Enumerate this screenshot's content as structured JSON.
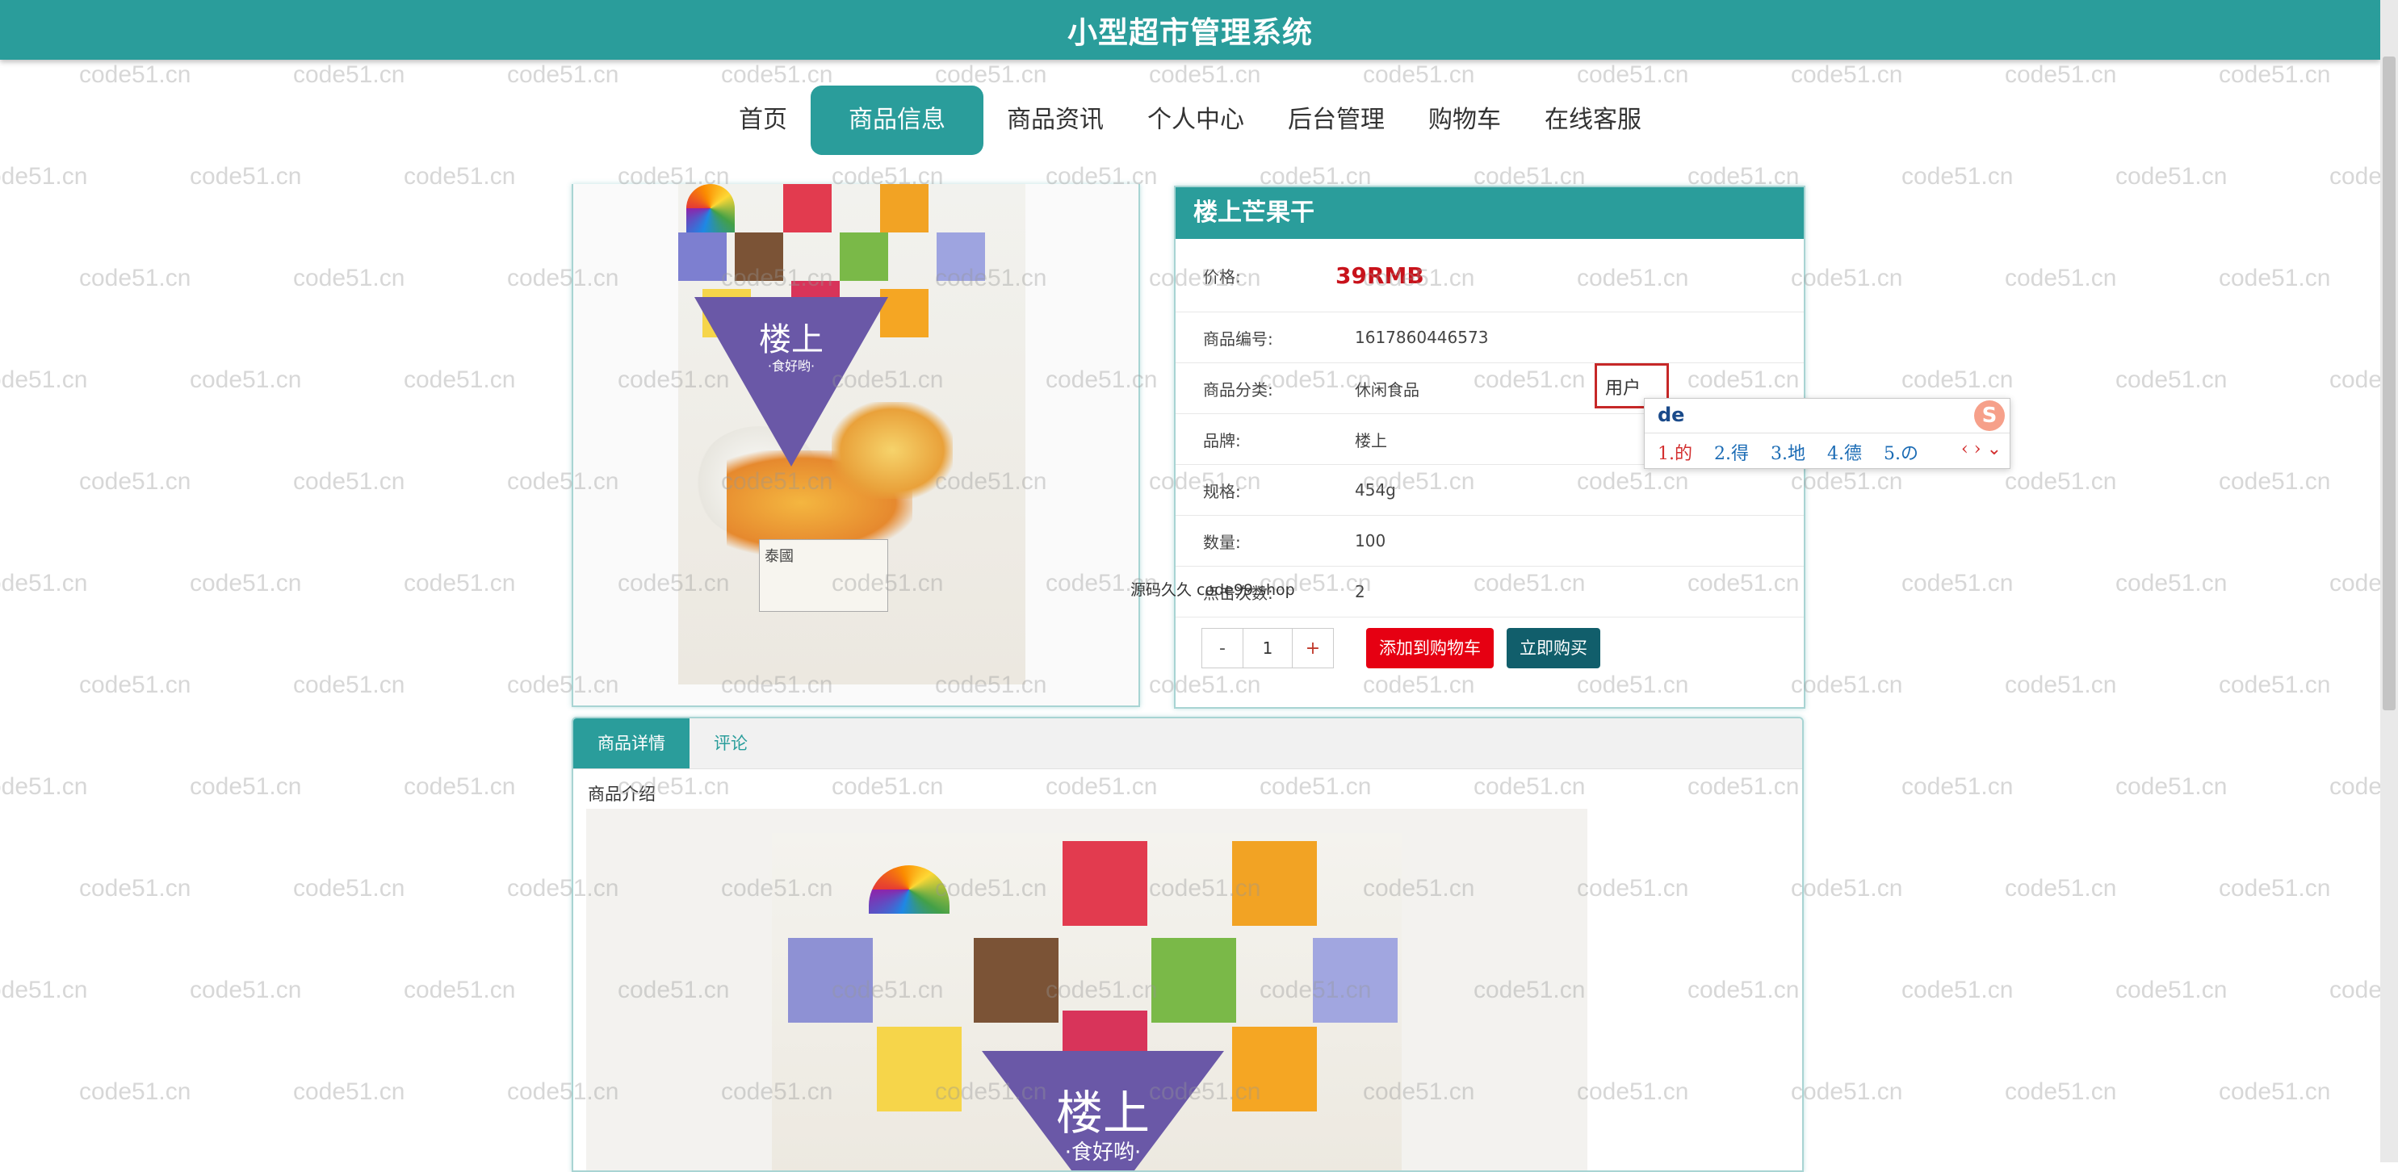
{
  "app": {
    "title": "小型超市管理系统"
  },
  "nav": {
    "items": [
      {
        "label": "首页"
      },
      {
        "label": "商品信息"
      },
      {
        "label": "商品资讯"
      },
      {
        "label": "个人中心"
      },
      {
        "label": "后台管理"
      },
      {
        "label": "购物车"
      },
      {
        "label": "在线客服"
      }
    ],
    "active": "商品信息"
  },
  "watermark": "code51.cn",
  "product": {
    "name": "楼上芒果干",
    "price_label": "价格:",
    "price": "39RMB",
    "fields": [
      {
        "label": "商品编号:",
        "value": "1617860446573"
      },
      {
        "label": "商品分类:",
        "value": "休闲食品"
      },
      {
        "label": "品牌:",
        "value": "楼上"
      },
      {
        "label": "规格:",
        "value": "454g"
      },
      {
        "label": "数量:",
        "value": "100"
      },
      {
        "label": "点击次数:",
        "value": "2"
      }
    ],
    "package_brand": "楼上",
    "package_slogan": "·食好哟·",
    "package_label": "泰國"
  },
  "purchase": {
    "minus": "-",
    "quantity": "1",
    "plus": "+",
    "add_to_cart": "添加到购物车",
    "buy_now": "立即购买"
  },
  "source_note": "源码久久 code99.shop",
  "ime": {
    "field_text": "用户",
    "input": "de",
    "candidates": [
      "1.的",
      "2.得",
      "3.地",
      "4.德",
      "5.の"
    ],
    "nav": "‹ › ⌄",
    "logo": "S"
  },
  "tabs": {
    "items": [
      {
        "label": "商品详情"
      },
      {
        "label": "评论"
      }
    ],
    "intro_label": "商品介绍"
  },
  "colors": {
    "primary": "#2a9d9b",
    "price": "#c8121b",
    "cart": "#e60012",
    "buy": "#115e6b"
  }
}
